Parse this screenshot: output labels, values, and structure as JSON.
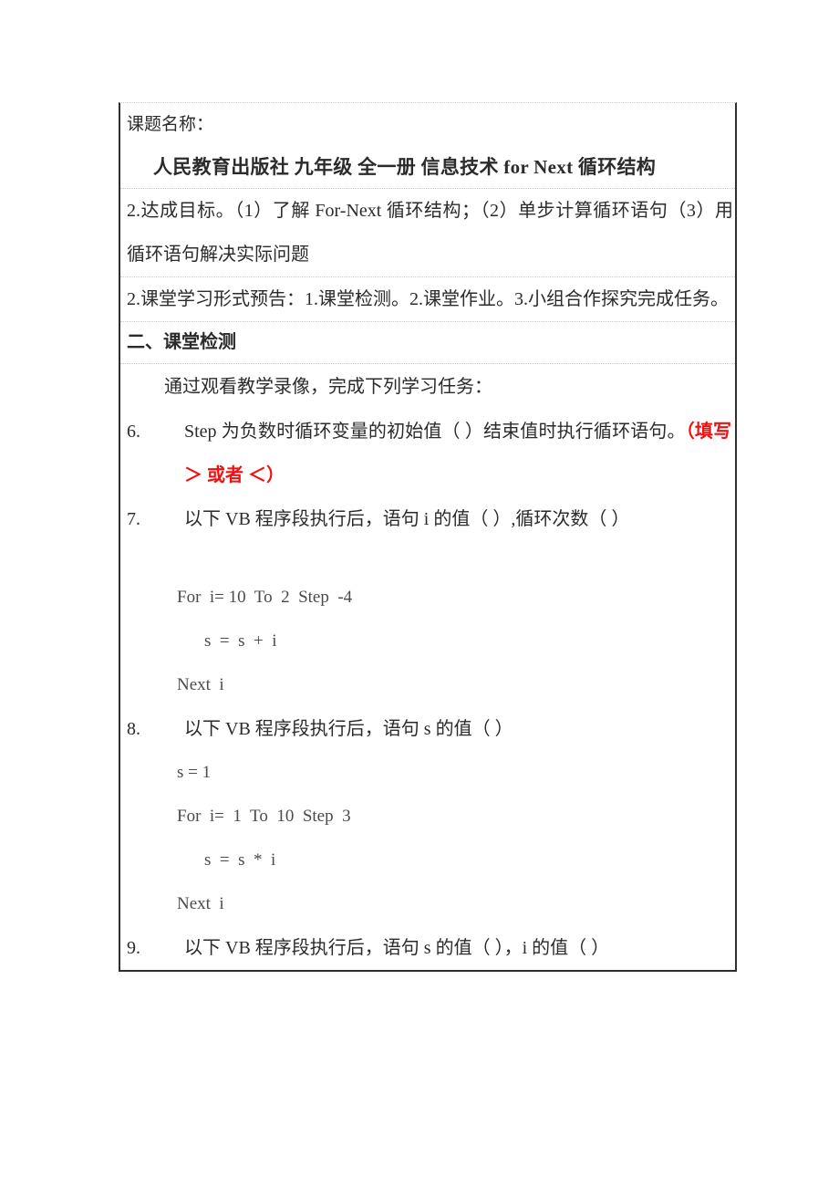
{
  "document": {
    "header": {
      "label": "课题名称：",
      "title": "人民教育出版社 九年级 全一册 信息技术 for Next 循环结构"
    },
    "rows": {
      "objectives": "2.达成目标。（1）了解 For-Next 循环结构；（2）单步计算循环语句（3）用循环语句解决实际问题",
      "class_format": "2.课堂学习形式预告：1.课堂检测。2.课堂作业。3.小组合作探究完成任务。",
      "section_heading": "二、课堂检测",
      "instruction": "通过观看教学录像，完成下列学习任务："
    },
    "questions": [
      {
        "number": "6.",
        "text": "Step 为负数时循环变量的初始值（      ）结束值时执行循环语句。",
        "hint": "（填写 ＞ 或者 ＜）"
      },
      {
        "number": "7.",
        "text": "以下 VB 程序段执行后，语句 i 的值（      ）,循环次数（    ）",
        "code": [
          "For  i= 10  To  2  Step  -4",
          "s  =  s  +  i",
          "Next  i"
        ]
      },
      {
        "number": "8.",
        "text": "以下 VB 程序段执行后，语句 s 的值（      ）",
        "pre_code": "s = 1",
        "code": [
          "For  i=  1  To  10  Step  3",
          "s  =  s  *  i",
          "Next  i"
        ]
      },
      {
        "number": "9.",
        "text": "以下 VB 程序段执行后，语句 s 的值（      ），i 的值（    ）"
      }
    ]
  }
}
